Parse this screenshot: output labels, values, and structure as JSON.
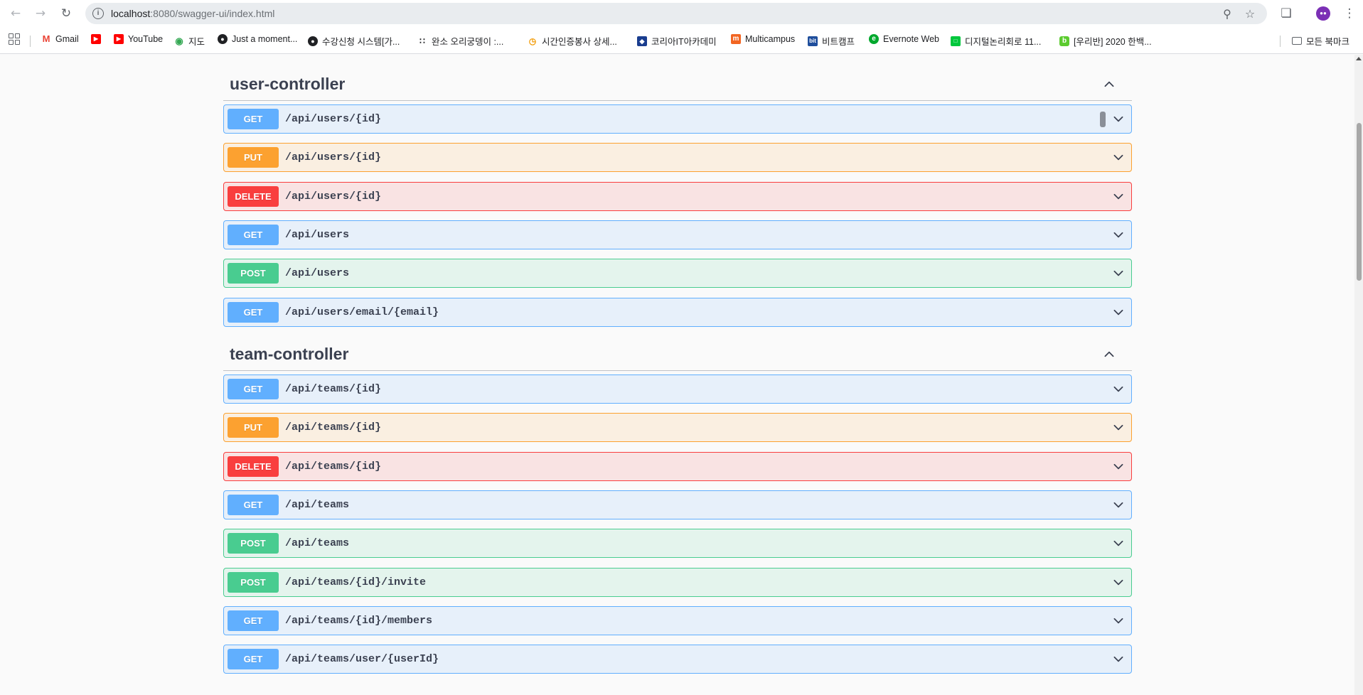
{
  "browser": {
    "url_host": "localhost",
    "url_rest": ":8080/swagger-ui/index.html",
    "bookmarks": [
      {
        "label": "Gmail",
        "color": "#ea4335"
      },
      {
        "label": "",
        "color": "#ff0000"
      },
      {
        "label": "YouTube",
        "color": "#ff0000"
      },
      {
        "label": "지도",
        "color": "#34a853"
      },
      {
        "label": "Just a moment...",
        "color": "#202124"
      },
      {
        "label": "수강신청 시스템[가...",
        "color": "#202124"
      },
      {
        "label": "완소 오리궁뎅이 :...",
        "color": "#202124"
      },
      {
        "label": "시간인증봉사 상세...",
        "color": "#f29900"
      },
      {
        "label": "코리아IT아카데미",
        "color": "#1a3d8f"
      },
      {
        "label": "Multicampus",
        "color": "#f26522"
      },
      {
        "label": "비트캠프",
        "color": "#1f4e9c"
      },
      {
        "label": "Evernote Web",
        "color": "#00a82d"
      },
      {
        "label": "디지털논리회로 11...",
        "color": "#00c73c"
      },
      {
        "label": "[우리반] 2020 한백...",
        "color": "#5ccb2f"
      }
    ],
    "all_bookmarks": "모든 북마크"
  },
  "sections": [
    {
      "title": "user-controller",
      "operations": [
        {
          "method": "GET",
          "path": "/api/users/{id}"
        },
        {
          "method": "PUT",
          "path": "/api/users/{id}"
        },
        {
          "method": "DELETE",
          "path": "/api/users/{id}"
        },
        {
          "method": "GET",
          "path": "/api/users"
        },
        {
          "method": "POST",
          "path": "/api/users"
        },
        {
          "method": "GET",
          "path": "/api/users/email/{email}"
        }
      ]
    },
    {
      "title": "team-controller",
      "operations": [
        {
          "method": "GET",
          "path": "/api/teams/{id}"
        },
        {
          "method": "PUT",
          "path": "/api/teams/{id}"
        },
        {
          "method": "DELETE",
          "path": "/api/teams/{id}"
        },
        {
          "method": "GET",
          "path": "/api/teams"
        },
        {
          "method": "POST",
          "path": "/api/teams"
        },
        {
          "method": "POST",
          "path": "/api/teams/{id}/invite"
        },
        {
          "method": "GET",
          "path": "/api/teams/{id}/members"
        },
        {
          "method": "GET",
          "path": "/api/teams/user/{userId}"
        }
      ]
    }
  ]
}
